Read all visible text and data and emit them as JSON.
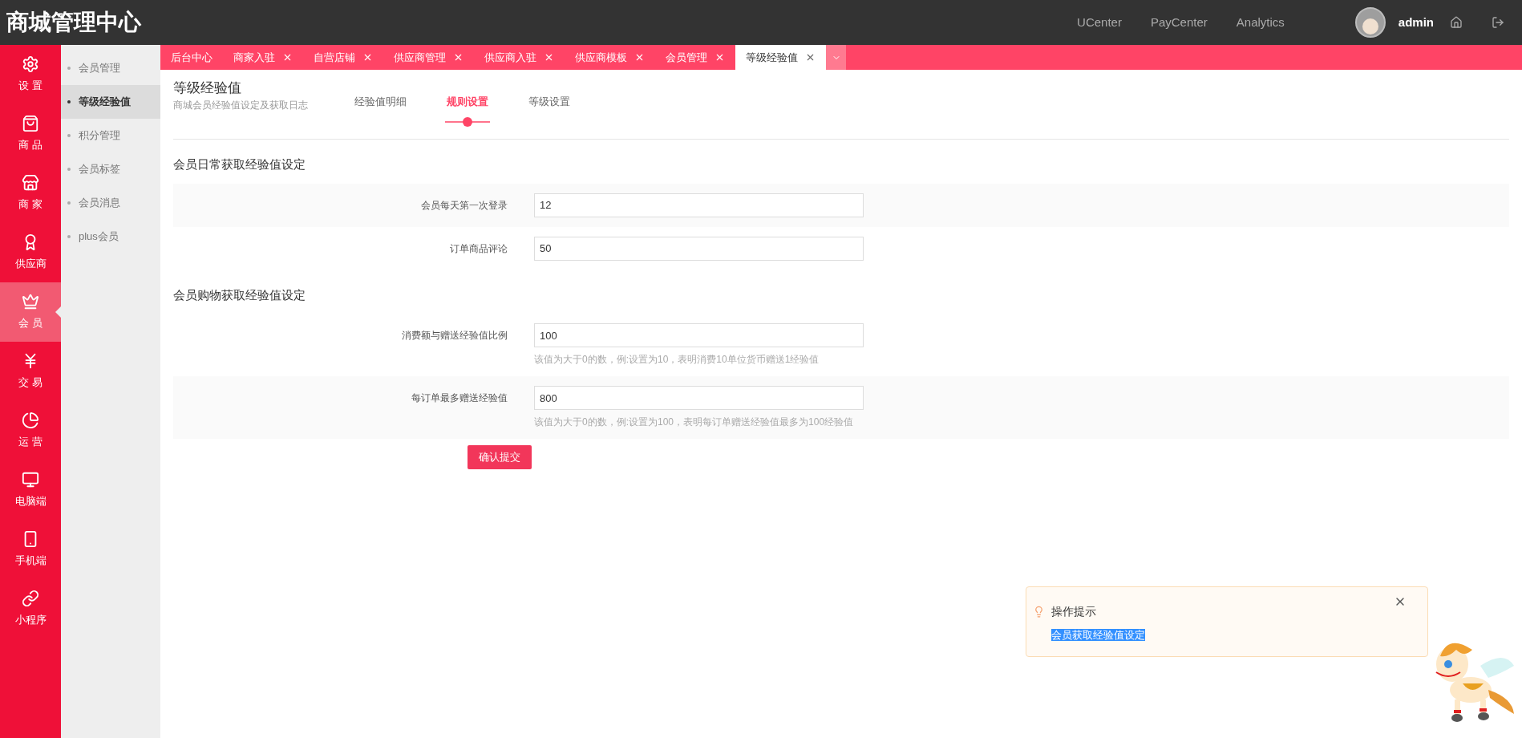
{
  "header": {
    "title": "商城管理中心",
    "links": [
      "UCenter",
      "PayCenter",
      "Analytics"
    ],
    "user": "admin"
  },
  "sidebar": {
    "items": [
      {
        "label": "设 置",
        "selected": false
      },
      {
        "label": "商 品",
        "selected": false
      },
      {
        "label": "商 家",
        "selected": false
      },
      {
        "label": "供应商",
        "selected": false
      },
      {
        "label": "会 员",
        "selected": true
      },
      {
        "label": "交 易",
        "selected": false
      },
      {
        "label": "运 营",
        "selected": false
      },
      {
        "label": "电脑端",
        "selected": false
      },
      {
        "label": "手机端",
        "selected": false
      },
      {
        "label": "小程序",
        "selected": false
      }
    ]
  },
  "subnav": {
    "items": [
      {
        "label": "会员管理",
        "selected": false
      },
      {
        "label": "等级经验值",
        "selected": true
      },
      {
        "label": "积分管理",
        "selected": false
      },
      {
        "label": "会员标签",
        "selected": false
      },
      {
        "label": "会员消息",
        "selected": false
      },
      {
        "label": "plus会员",
        "selected": false
      }
    ]
  },
  "tabs": [
    {
      "label": "后台中心",
      "selected": false,
      "closable": false
    },
    {
      "label": "商家入驻",
      "selected": false,
      "closable": true
    },
    {
      "label": "自营店铺",
      "selected": false,
      "closable": true
    },
    {
      "label": "供应商管理",
      "selected": false,
      "closable": true
    },
    {
      "label": "供应商入驻",
      "selected": false,
      "closable": true
    },
    {
      "label": "供应商模板",
      "selected": false,
      "closable": true
    },
    {
      "label": "会员管理",
      "selected": false,
      "closable": true
    },
    {
      "label": "等级经验值",
      "selected": true,
      "closable": true
    }
  ],
  "page": {
    "title": "等级经验值",
    "subtitle": "商城会员经验值设定及获取日志",
    "subtabs": [
      {
        "label": "经验值明细",
        "selected": false
      },
      {
        "label": "规则设置",
        "selected": true
      },
      {
        "label": "等级设置",
        "selected": false
      }
    ]
  },
  "sections": [
    {
      "title": "会员日常获取经验值设定",
      "rows": [
        {
          "label": "会员每天第一次登录",
          "value": "12"
        },
        {
          "label": "订单商品评论",
          "value": "50"
        }
      ]
    },
    {
      "title": "会员购物获取经验值设定",
      "rows": [
        {
          "label": "消费额与赠送经验值比例",
          "value": "100",
          "hint": "该值为大于0的数，例:设置为10，表明消费10单位货币赠送1经验值"
        },
        {
          "label": "每订单最多赠送经验值",
          "value": "800",
          "hint": "该值为大于0的数，例:设置为100，表明每订单赠送经验值最多为100经验值"
        }
      ]
    }
  ],
  "submit": "确认提交",
  "tip": {
    "title": "操作提示",
    "text": "会员获取经验值设定",
    "highlighted": true
  }
}
